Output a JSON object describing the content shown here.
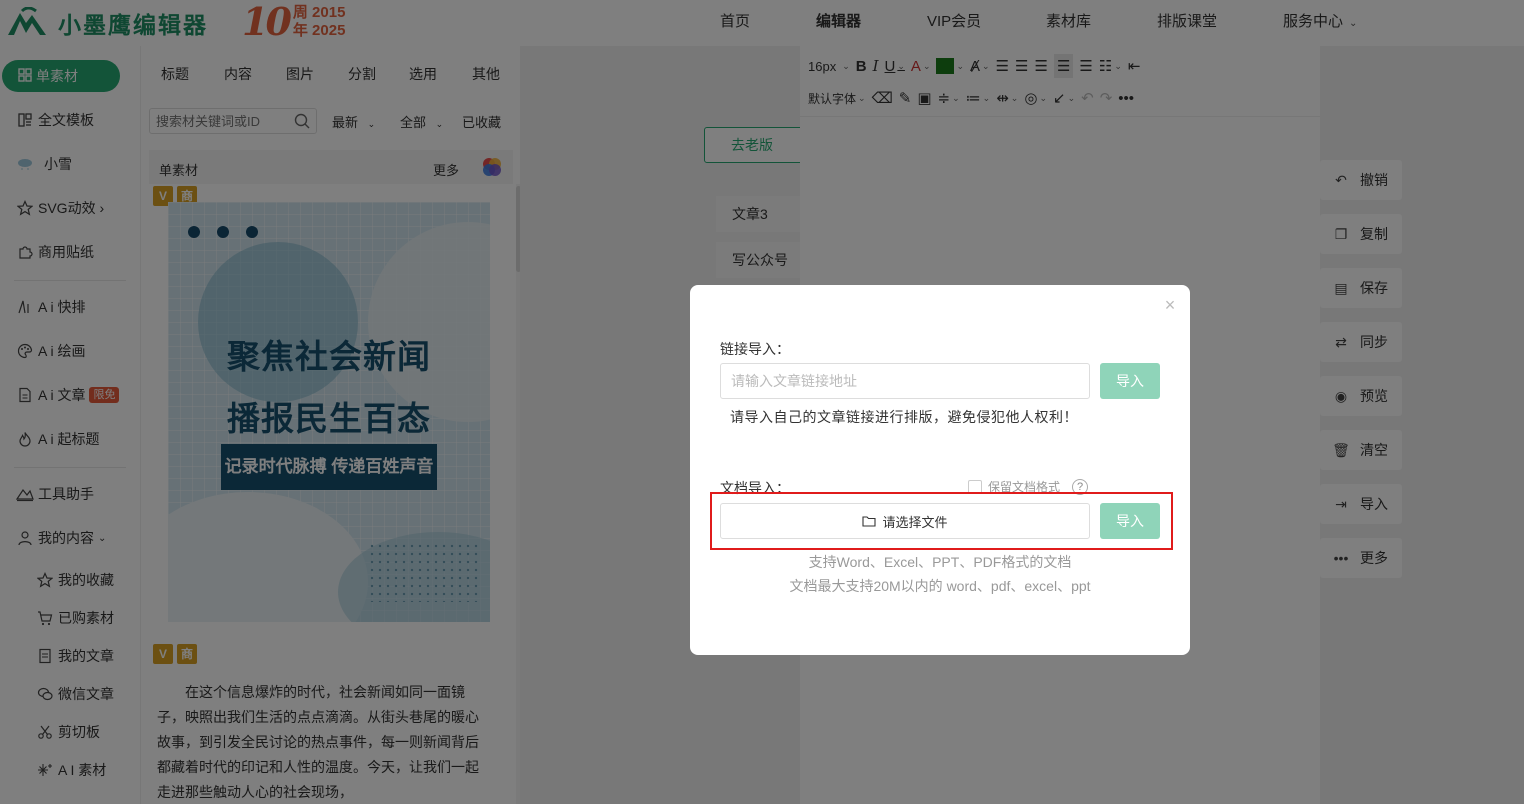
{
  "brand": {
    "name": "小墨鹰编辑器",
    "anniversary_number": "10",
    "anniversary_line1": "周 2015",
    "anniversary_line2": "年 2025"
  },
  "nav": [
    {
      "label": "首页",
      "active": false
    },
    {
      "label": "编辑器",
      "active": true
    },
    {
      "label": "VIP会员",
      "active": false
    },
    {
      "label": "素材库",
      "active": false
    },
    {
      "label": "排版课堂",
      "active": false
    },
    {
      "label": "服务中心",
      "active": false,
      "dropdown": true
    }
  ],
  "sidebar": {
    "active": "单素材",
    "items": [
      {
        "label": "全文模板",
        "icon": "template-icon"
      },
      {
        "label": "小雪",
        "icon": "snow-cloud-icon"
      },
      {
        "label": "SVG动效 ›",
        "icon": "star-icon"
      },
      {
        "label": "商用贴纸",
        "icon": "puzzle-icon"
      },
      {
        "label": "A i 快排",
        "icon": "ai-quick-icon"
      },
      {
        "label": "A i 绘画",
        "icon": "palette-icon"
      },
      {
        "label": "A i 文章",
        "icon": "document-icon",
        "badge": "限免"
      },
      {
        "label": "A i 起标题",
        "icon": "flame-icon"
      },
      {
        "label": "工具助手",
        "icon": "tool-icon"
      },
      {
        "label": "我的内容",
        "icon": "user-icon"
      },
      {
        "label": "我的收藏",
        "icon": "star-icon"
      },
      {
        "label": "已购素材",
        "icon": "cart-icon"
      },
      {
        "label": "我的文章",
        "icon": "article-icon"
      },
      {
        "label": "微信文章",
        "icon": "wechat-icon"
      },
      {
        "label": "剪切板",
        "icon": "scissors-icon"
      },
      {
        "label": "A I 素材",
        "icon": "sparkle-icon"
      }
    ]
  },
  "panel": {
    "tabs": [
      "标题",
      "内容",
      "图片",
      "分割",
      "选用",
      "其他"
    ],
    "search_placeholder": "搜索材关键词或ID",
    "filters": [
      "最新",
      "全部",
      "已收藏"
    ],
    "section_title": "单素材",
    "more_label": "更多",
    "tag_v": "V",
    "tag_shang": "商",
    "poster": {
      "line1": "聚焦社会新闻",
      "line2": "播报民生百态",
      "band": "记录时代脉搏 传递百姓声音"
    },
    "article_text": "在这个信息爆炸的时代，社会新闻如同一面镜子，映照出我们生活的点点滴滴。从街头巷尾的暖心故事，到引发全民讨论的热点事件，每一则新闻背后都藏着时代的印记和人性的温度。今天，让我们一起走进那些触动人心的社会现场，"
  },
  "editor": {
    "old_version": "去老版",
    "docs": [
      "文章3",
      "写公众号"
    ],
    "font_size": "16px",
    "font_family": "默认字体"
  },
  "right_actions": [
    {
      "label": "撤销",
      "icon": "undo-icon"
    },
    {
      "label": "复制",
      "icon": "copy-icon"
    },
    {
      "label": "保存",
      "icon": "save-icon"
    },
    {
      "label": "同步",
      "icon": "sync-icon"
    },
    {
      "label": "预览",
      "icon": "eye-icon"
    },
    {
      "label": "清空",
      "icon": "trash-icon"
    },
    {
      "label": "导入",
      "icon": "import-icon"
    },
    {
      "label": "更多",
      "icon": "more-icon"
    }
  ],
  "modal": {
    "link_label": "链接导入：",
    "link_placeholder": "请输入文章链接地址",
    "import_label": "导入",
    "warning": "请导入自己的文章链接进行排版，避免侵犯他人权利！",
    "doc_label": "文档导入：",
    "keep_format": "保留文档格式",
    "help": "?",
    "choose_file": "请选择文件",
    "hint1": "支持Word、Excel、PPT、PDF格式的文档",
    "hint2": "文档最大支持20M以内的 word、pdf、excel、ppt",
    "close": "×"
  },
  "colors": {
    "brand_green": "#26a872",
    "button_disabled_green": "#8fd4b9",
    "highlight_red": "#e01b1b",
    "anniversary_orange": "#e2633f"
  }
}
